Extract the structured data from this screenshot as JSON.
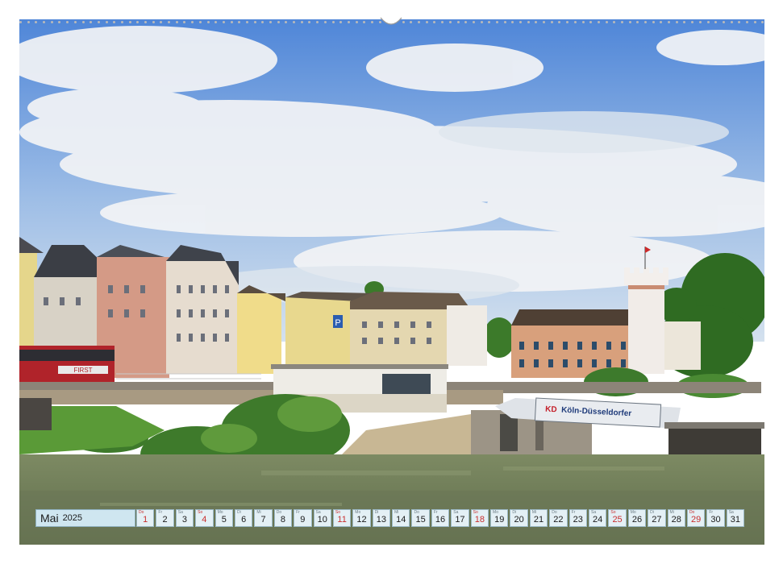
{
  "calendar": {
    "month": "Mai",
    "year": "2025",
    "days": [
      {
        "dow": "Do",
        "num": "1",
        "red": true
      },
      {
        "dow": "Fr",
        "num": "2",
        "red": false
      },
      {
        "dow": "Sa",
        "num": "3",
        "red": false
      },
      {
        "dow": "So",
        "num": "4",
        "red": true
      },
      {
        "dow": "Mo",
        "num": "5",
        "red": false
      },
      {
        "dow": "Di",
        "num": "6",
        "red": false
      },
      {
        "dow": "Mi",
        "num": "7",
        "red": false
      },
      {
        "dow": "Do",
        "num": "8",
        "red": false
      },
      {
        "dow": "Fr",
        "num": "9",
        "red": false
      },
      {
        "dow": "Sa",
        "num": "10",
        "red": false
      },
      {
        "dow": "So",
        "num": "11",
        "red": true
      },
      {
        "dow": "Mo",
        "num": "12",
        "red": false
      },
      {
        "dow": "Di",
        "num": "13",
        "red": false
      },
      {
        "dow": "Mi",
        "num": "14",
        "red": false
      },
      {
        "dow": "Do",
        "num": "15",
        "red": false
      },
      {
        "dow": "Fr",
        "num": "16",
        "red": false
      },
      {
        "dow": "Sa",
        "num": "17",
        "red": false
      },
      {
        "dow": "So",
        "num": "18",
        "red": true
      },
      {
        "dow": "Mo",
        "num": "19",
        "red": false
      },
      {
        "dow": "Di",
        "num": "20",
        "red": false
      },
      {
        "dow": "Mi",
        "num": "21",
        "red": false
      },
      {
        "dow": "Do",
        "num": "22",
        "red": false
      },
      {
        "dow": "Fr",
        "num": "23",
        "red": false
      },
      {
        "dow": "Sa",
        "num": "24",
        "red": false
      },
      {
        "dow": "So",
        "num": "25",
        "red": true
      },
      {
        "dow": "Mo",
        "num": "26",
        "red": false
      },
      {
        "dow": "Di",
        "num": "27",
        "red": false
      },
      {
        "dow": "Mi",
        "num": "28",
        "red": false
      },
      {
        "dow": "Do",
        "num": "29",
        "red": true
      },
      {
        "dow": "Fr",
        "num": "30",
        "red": false
      },
      {
        "dow": "Sa",
        "num": "31",
        "red": false
      }
    ]
  },
  "photo": {
    "pier_sign": "Köln-Düsseldorfer",
    "pier_logo": "KD",
    "bus_text": "FIRST",
    "building_sign": "P"
  },
  "colors": {
    "sky_top": "#4f86d8",
    "water": "#6f7d58",
    "holiday_red": "#c92f2f",
    "strip_bg": "#e4f0f5",
    "month_bg": "#cfe6f0"
  }
}
